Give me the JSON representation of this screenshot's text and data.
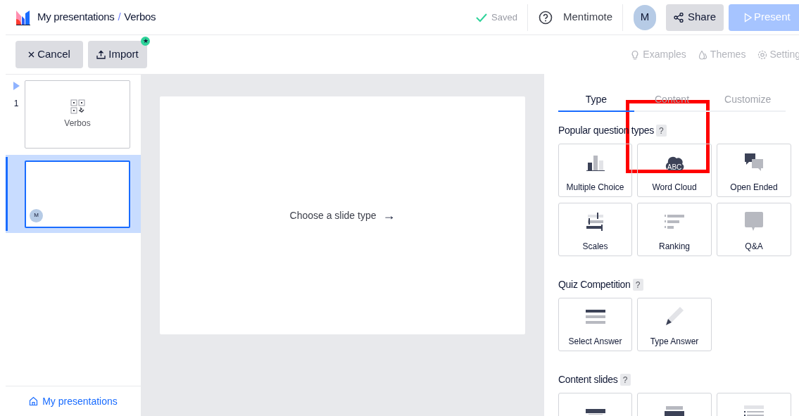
{
  "header": {
    "breadcrumb": "My presentations",
    "separator": "/",
    "title": "Verbos",
    "saved": "Saved",
    "help_label": "Mentimote",
    "avatar": "M",
    "share": "Share",
    "present": "Present"
  },
  "toolbar": {
    "cancel": "Cancel",
    "import": "Import",
    "import_badge": "★",
    "links": [
      {
        "kind": "examples",
        "label": "Examples"
      },
      {
        "kind": "themes",
        "label": "Themes"
      },
      {
        "kind": "settings",
        "label": "Setting"
      }
    ]
  },
  "slides": [
    {
      "number": "1",
      "selected": false,
      "title": "Verbos",
      "current": true
    },
    {
      "selected": true,
      "current": false,
      "avatar": "M"
    }
  ],
  "sidebar_link": "My presentations",
  "canvas": {
    "prompt": "Choose a slide type",
    "arrow": "→"
  },
  "panel": {
    "tabs": [
      {
        "label": "Type",
        "selected": true
      },
      {
        "label": "Content",
        "selected": false
      },
      {
        "label": "Customize",
        "selected": false
      }
    ],
    "sections": [
      {
        "title": "Popular question types",
        "help": "?",
        "items": [
          {
            "kind": "multiple_choice",
            "label": "Multiple Choice"
          },
          {
            "kind": "word_cloud",
            "label": "Word Cloud",
            "icon_text": "ABC"
          },
          {
            "kind": "open_ended",
            "label": "Open Ended"
          },
          {
            "kind": "scales",
            "label": "Scales"
          },
          {
            "kind": "ranking",
            "label": "Ranking"
          },
          {
            "kind": "qa",
            "label": "Q&A"
          }
        ]
      },
      {
        "title": "Quiz Competition",
        "help": "?",
        "items": [
          {
            "kind": "select_answer",
            "label": "Select Answer"
          },
          {
            "kind": "type_answer",
            "label": "Type Answer"
          }
        ]
      },
      {
        "title": "Content slides",
        "help": "?",
        "items": [
          {
            "kind": "heading"
          },
          {
            "kind": "image"
          },
          {
            "kind": "bullets"
          }
        ]
      }
    ]
  },
  "annotation": {
    "kind": "highlight"
  }
}
